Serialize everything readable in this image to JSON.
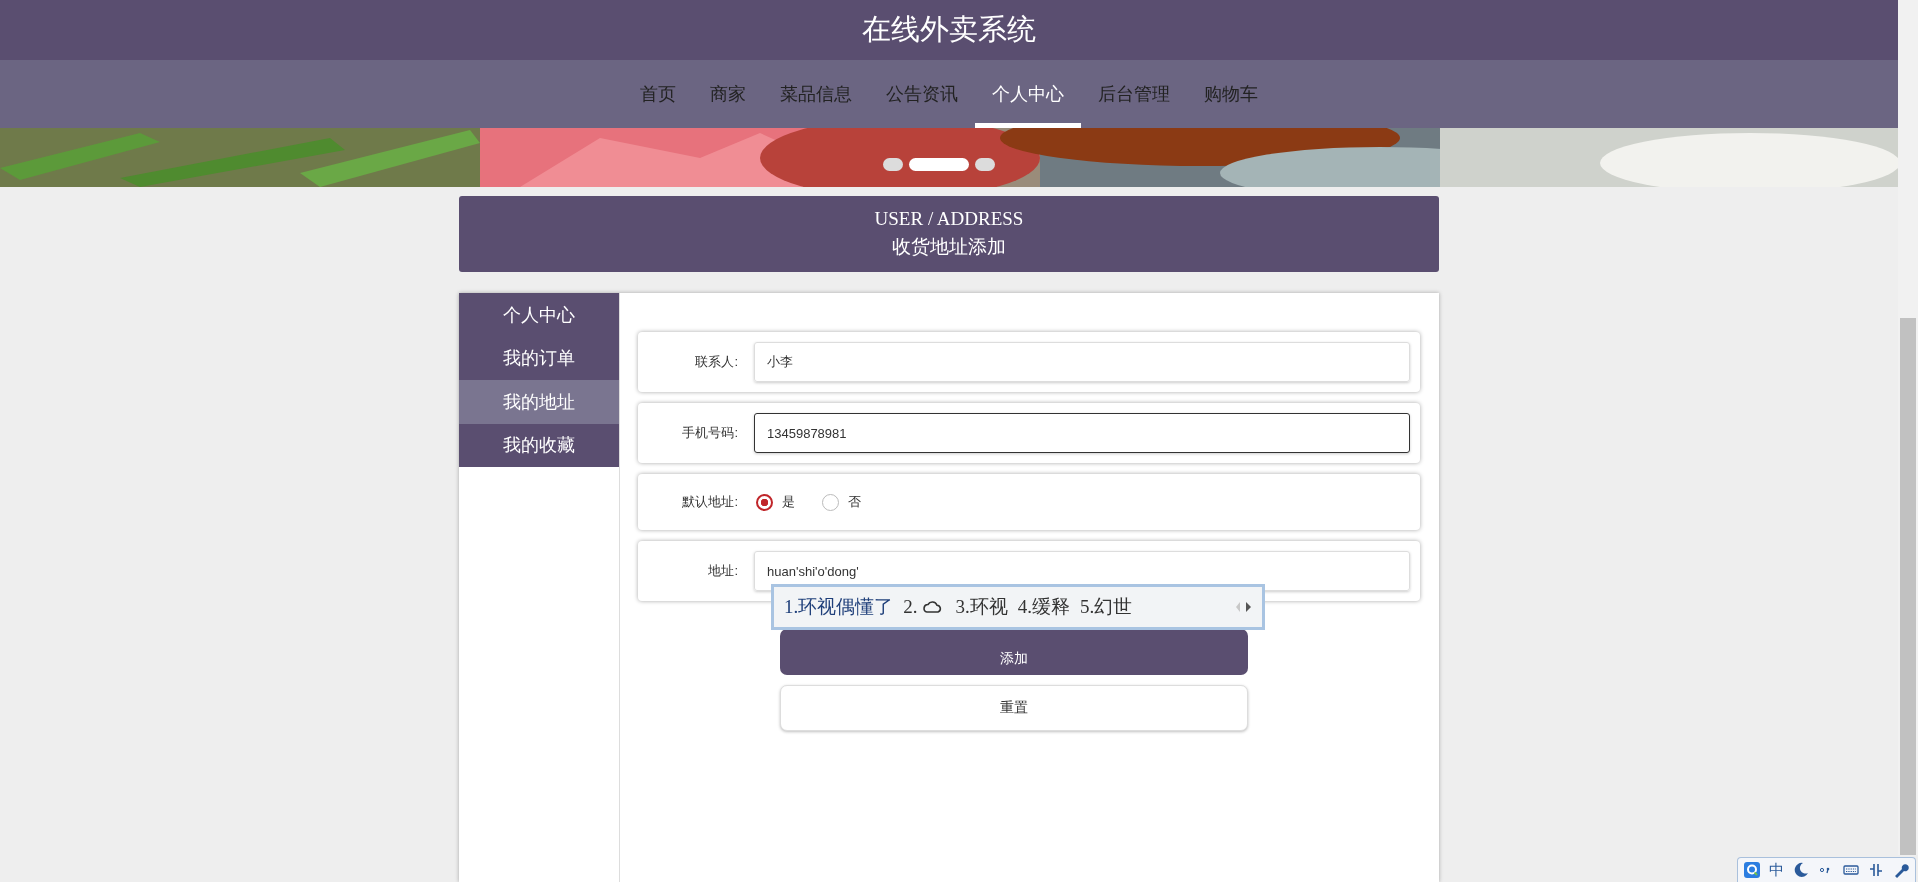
{
  "site_title": "在线外卖系统",
  "nav": [
    {
      "label": "首页",
      "selected": false
    },
    {
      "label": "商家",
      "selected": false
    },
    {
      "label": "菜品信息",
      "selected": false
    },
    {
      "label": "公告资讯",
      "selected": false
    },
    {
      "label": "个人中心",
      "selected": true
    },
    {
      "label": "后台管理",
      "selected": false
    },
    {
      "label": "购物车",
      "selected": false
    }
  ],
  "banner": {
    "kind": "picture",
    "slides": [
      {
        "selected": false
      },
      {
        "selected": true
      },
      {
        "selected": false
      }
    ]
  },
  "page_heading": {
    "en": "USER / ADDRESS",
    "zh": "收货地址添加"
  },
  "sidebar": [
    {
      "label": "个人中心",
      "selected": false
    },
    {
      "label": "我的订单",
      "selected": false
    },
    {
      "label": "我的地址",
      "selected": true
    },
    {
      "label": "我的收藏",
      "selected": false
    }
  ],
  "form": {
    "fields": [
      {
        "kind": "text",
        "label": "联系人:",
        "value": "小李",
        "focused": false
      },
      {
        "kind": "text",
        "label": "手机号码:",
        "value": "13459878981",
        "focused": true
      },
      {
        "kind": "radio",
        "label": "默认地址:",
        "options": [
          {
            "label": "是",
            "selected": true
          },
          {
            "label": "否",
            "selected": false
          }
        ]
      },
      {
        "kind": "text",
        "label": "地址:",
        "value": "huan'shi'o'dong'",
        "focused": false
      }
    ]
  },
  "buttons": [
    {
      "kind": "primary",
      "label": "添加"
    },
    {
      "kind": "secondary",
      "label": "重置"
    }
  ],
  "ime": {
    "candidates": [
      {
        "kind": "text",
        "index": "1.",
        "text": "环视偶懂了"
      },
      {
        "kind": "cloud",
        "index": "2."
      },
      {
        "kind": "text",
        "index": "3.",
        "text": "环视"
      },
      {
        "kind": "text",
        "index": "4.",
        "text": "缓释"
      },
      {
        "kind": "text",
        "index": "5.",
        "text": "幻世"
      }
    ]
  },
  "ime_toolbar": {
    "mode": "中"
  }
}
